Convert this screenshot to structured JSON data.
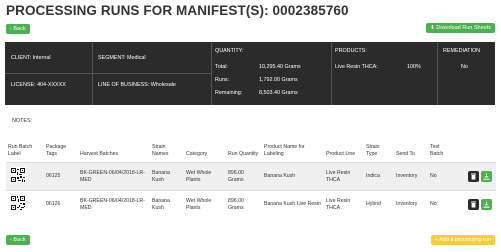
{
  "page": {
    "title": "PROCESSING RUNS FOR MANIFEST(S): 0002385760",
    "back_label": "‹ Back",
    "download_label": "⬇ Download Run Sheets",
    "add_run_label": "+ Add a processing run",
    "notes_label": "NOTES:"
  },
  "manifest": {
    "client": "CLIENT: Internal",
    "segment": "SEGMENT: Medical",
    "license": "LICENSE: 404-XXXXX",
    "line_of_business": "LINE OF BUSINESS: Wholesale",
    "quantity_header": "QUANTITY:",
    "total_label": "Total:",
    "total_value": "10,295.40 Grams",
    "runs_label": "Runs:",
    "runs_value": "1,792.00 Grams",
    "remaining_label": "Remaining:",
    "remaining_value": "8,503.40 Grams",
    "products_header": "PRODUCTS:",
    "product_name": "Live Resin THCA:",
    "product_pct": "100%",
    "remediation_header": "REMEDIATION",
    "remediation_value": "No"
  },
  "table": {
    "headers": {
      "label": "Run Batch Label",
      "tags": "Package Tags",
      "batches": "Harvest Batches",
      "strain": "Strain Names",
      "category": "Category",
      "qty": "Run Quantity",
      "product": "Product Name for Labeling",
      "line": "Product Line",
      "type": "Strain Type",
      "send": "Send To",
      "test": "Test Batch"
    },
    "rows": [
      {
        "tag": "06125",
        "batch": "BK-GREEN-06/04/2018-LR-MED",
        "strain": "Banana Kush",
        "category": "Wet Whole Plants",
        "qty": "896.00 Grams",
        "product": "Banana Kush",
        "line": "Live Resin THCA",
        "type": "Indica",
        "send": "Inventory",
        "test": "No"
      },
      {
        "tag": "06126",
        "batch": "BK-GREEN-06/04/2018-LR-MED",
        "strain": "Banana Kush",
        "category": "Wet Whole Plants",
        "qty": "896.00 Grams",
        "product": "Banana Kush Live Resin",
        "line": "Live Resin THCA",
        "type": "Hybrid",
        "send": "Inventory",
        "test": "No"
      }
    ]
  },
  "colors": {
    "accent_green": "#4caf50",
    "panel_dark": "#2b2b2b",
    "add_yellow": "#f7cc3e"
  }
}
